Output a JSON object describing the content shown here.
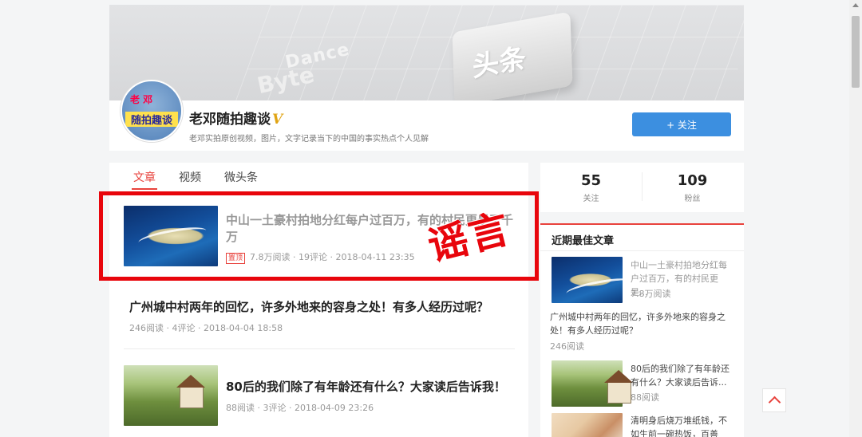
{
  "banner": {
    "brand_small": "Dance",
    "brand_big": "Byte",
    "tile_text": "头条"
  },
  "profile": {
    "avatar_text_top": "老 邓",
    "avatar_text_main": "随拍趣谈",
    "name": "老邓随拍趣谈",
    "verified_mark": "V",
    "description": "老邓实拍原创视频，图片，文字记录当下的中国的事实热点个人见解",
    "follow_label": "+ 关注"
  },
  "tabs": [
    "文章",
    "视频",
    "微头条"
  ],
  "active_tab": "文章",
  "articles": [
    {
      "title": "中山一土豪村拍地分红每户过百万，有的村民更是了千万",
      "pinned_label": "置顶",
      "meta": "7.8万阅读 · 19评论 · 2018-04-11 23:35"
    },
    {
      "title": "广州城中村两年的回忆，许多外地来的容身之处！有多人经历过呢？",
      "meta": "246阅读 · 4评论 · 2018-04-04 18:58"
    },
    {
      "title": "80后的我们除了有年龄还有什么？大家读后告诉我！",
      "meta": "88阅读 · 3评论 · 2018-04-09 23:26"
    }
  ],
  "stamp_text": "谣言",
  "stats": [
    {
      "value": "55",
      "label": "关注"
    },
    {
      "value": "109",
      "label": "粉丝"
    }
  ],
  "best": {
    "title": "近期最佳文章",
    "items": [
      {
        "title": "中山一土豪村拍地分红每户过百万，有的村民更是...",
        "meta": "7.8万阅读"
      },
      {
        "title": "广州城中村两年的回忆，许多外地来的容身之处！有多人经历过呢？",
        "meta": "246阅读"
      },
      {
        "title": "80后的我们除了有年龄还有什么？大家读后告诉...",
        "meta": "88阅读"
      },
      {
        "title": "清明身后烧万堆纸钱，不如生前一碗热饭，百善孝..."
      }
    ]
  },
  "colors": {
    "accent": "#e8423c",
    "follow_button": "#3c8fe0",
    "rumor_red": "#e8050c"
  }
}
